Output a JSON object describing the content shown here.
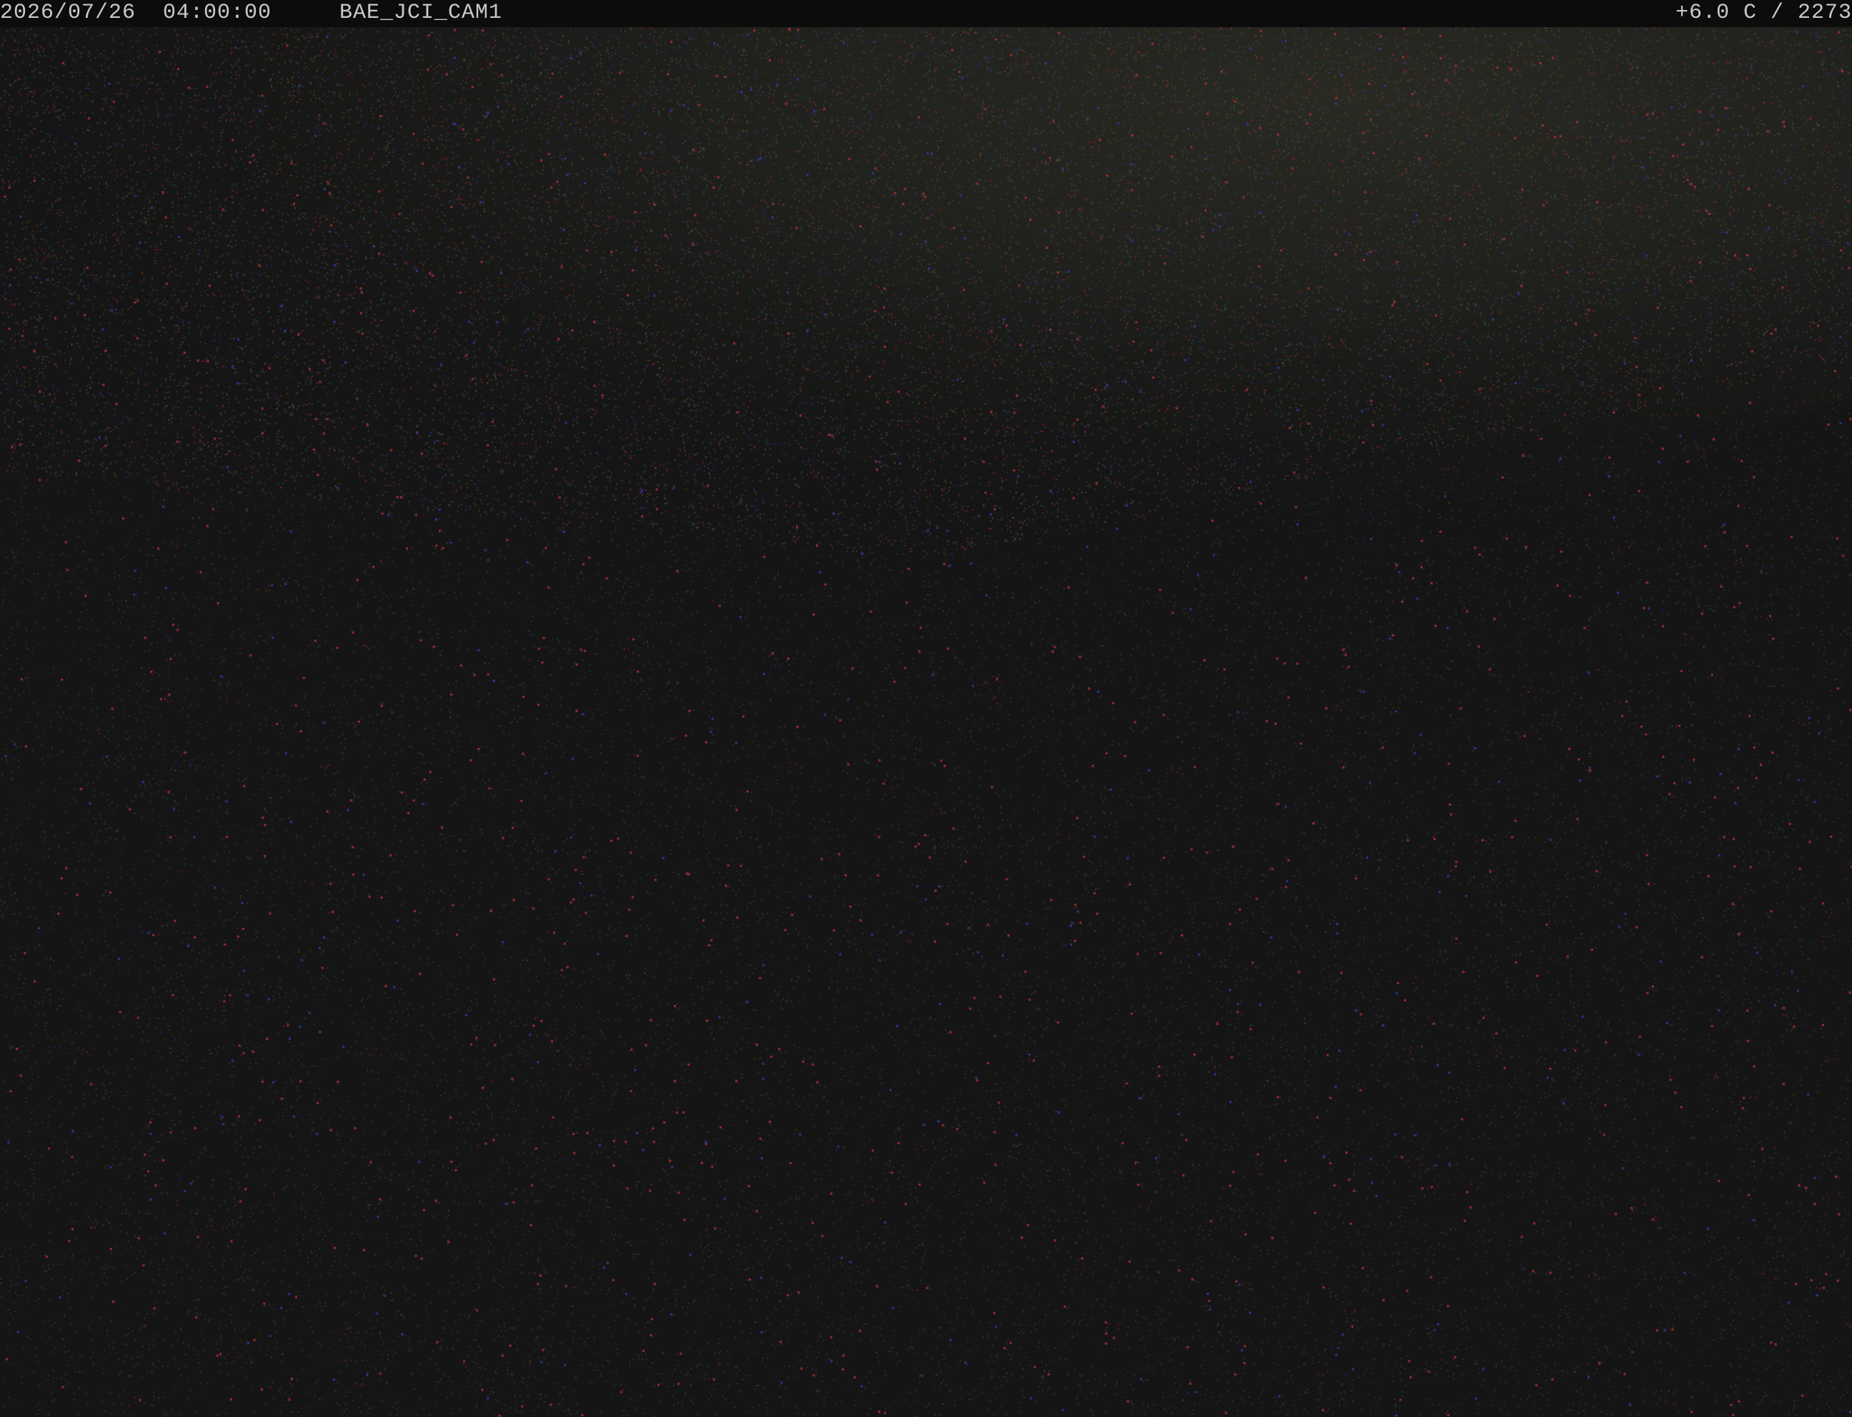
{
  "overlay": {
    "datetime": "2026/07/26  04:00:00",
    "camera_id": "BAE_JCI_CAM1",
    "temp_reading": "+6.0 C / 2273"
  },
  "colors": {
    "background": "#151515",
    "overlay_bar": "#0c0c0c",
    "overlay_text": "#c9c9c9",
    "noise_red": "#b03040",
    "noise_green": "#3f6a3a",
    "noise_blue": "#3a3aa0"
  },
  "scene": {
    "content": "night-sky-webcam-frame",
    "brighter_region": "upper-right-sky"
  }
}
